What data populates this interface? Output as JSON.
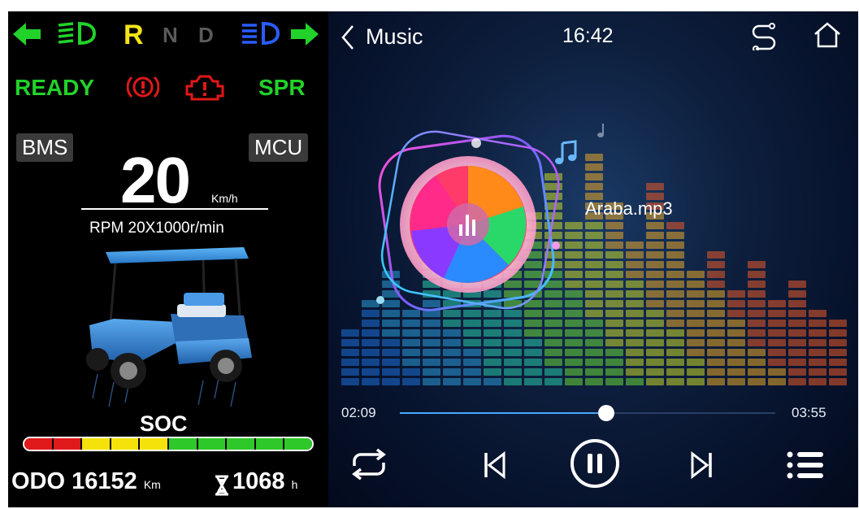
{
  "cluster": {
    "gears": {
      "r": "R",
      "n": "N",
      "d": "D"
    },
    "status": {
      "ready": "READY",
      "spr": "SPR"
    },
    "bms_label": "BMS",
    "mcu_label": "MCU",
    "speed_value": "20",
    "speed_unit": "Km/h",
    "rpm_text": "RPM 20X1000r/min",
    "soc_label": "SOC",
    "soc_segments": [
      "#e01a1a",
      "#e01a1a",
      "#f5e20a",
      "#f5e20a",
      "#f5e20a",
      "#2fc82a",
      "#2fc82a",
      "#2fc82a",
      "#2fc82a",
      "#2fc82a"
    ],
    "odo_label": "ODO",
    "odo_value": "16152",
    "odo_unit": "Km",
    "hours_value": "1068",
    "hours_unit": "h",
    "colors": {
      "green": "#22d22a",
      "yellow": "#f2e418",
      "gray": "#5a5a5a",
      "blue": "#2a5cff",
      "red": "#e01818"
    },
    "icons": [
      "left-arrow-icon",
      "low-beam-icon",
      "high-beam-icon",
      "right-arrow-icon",
      "brake-warning-icon",
      "motor-fault-icon",
      "hourglass-icon"
    ]
  },
  "player": {
    "title": "Music",
    "clock": "16:42",
    "track_name": "Araba.mp3",
    "elapsed": "02:09",
    "duration": "03:55",
    "progress": 0.55,
    "icons": [
      "back-chevron-icon",
      "route-icon",
      "home-icon",
      "music-note-icon",
      "repeat-icon",
      "previous-icon",
      "pause-icon",
      "next-icon",
      "playlist-icon"
    ]
  }
}
